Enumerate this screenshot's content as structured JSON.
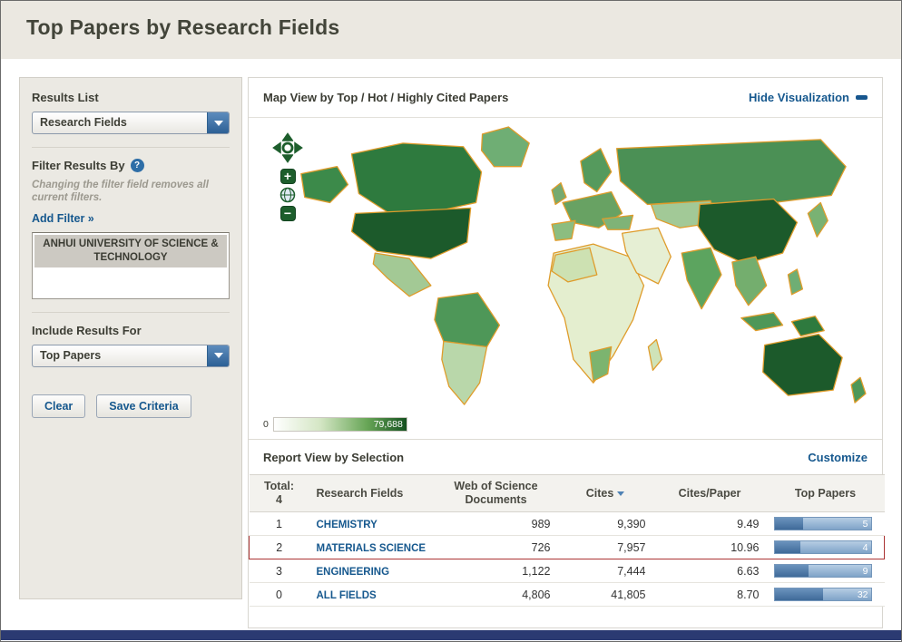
{
  "page": {
    "title": "Top Papers by Research Fields"
  },
  "sidebar": {
    "results_list": {
      "label": "Results List",
      "value": "Research Fields"
    },
    "filter": {
      "label": "Filter Results By",
      "help_icon": "?",
      "note": "Changing the filter field removes all current filters.",
      "add_filter": "Add Filter »",
      "items": [
        "ANHUI UNIVERSITY OF SCIENCE & TECHNOLOGY"
      ]
    },
    "include": {
      "label": "Include Results For",
      "value": "Top Papers"
    },
    "buttons": {
      "clear": "Clear",
      "save": "Save Criteria"
    }
  },
  "visualization": {
    "header": "Map View by Top / Hot / Highly Cited Papers",
    "hide_link": "Hide Visualization",
    "legend": {
      "min": "0",
      "max": "79,688"
    }
  },
  "report": {
    "header": "Report View by Selection",
    "customize": "Customize",
    "table": {
      "rank_header_line1": "Total:",
      "rank_header_line2": "4",
      "columns": {
        "field": "Research Fields",
        "docs": "Web of Science Documents",
        "cites": "Cites",
        "cites_per_paper": "Cites/Paper",
        "top_papers": "Top Papers"
      },
      "rows": [
        {
          "rank": "1",
          "field": "CHEMISTRY",
          "docs": "989",
          "cites": "9,390",
          "cpp": "9.49",
          "top": "5",
          "bar_pct": 30,
          "highlighted": false
        },
        {
          "rank": "2",
          "field": "MATERIALS SCIENCE",
          "docs": "726",
          "cites": "7,957",
          "cpp": "10.96",
          "top": "4",
          "bar_pct": 27,
          "highlighted": true
        },
        {
          "rank": "3",
          "field": "ENGINEERING",
          "docs": "1,122",
          "cites": "7,444",
          "cpp": "6.63",
          "top": "9",
          "bar_pct": 35,
          "highlighted": false
        },
        {
          "rank": "0",
          "field": "ALL FIELDS",
          "docs": "4,806",
          "cites": "41,805",
          "cpp": "8.70",
          "top": "32",
          "bar_pct": 50,
          "highlighted": false
        }
      ]
    }
  },
  "colors": {
    "accent_blue": "#16588e",
    "highlight_red": "#ab3434",
    "map_dark_green": "#1c5a2b",
    "footer_navy": "#2b3a72",
    "header_bg": "#ebe8e1"
  }
}
